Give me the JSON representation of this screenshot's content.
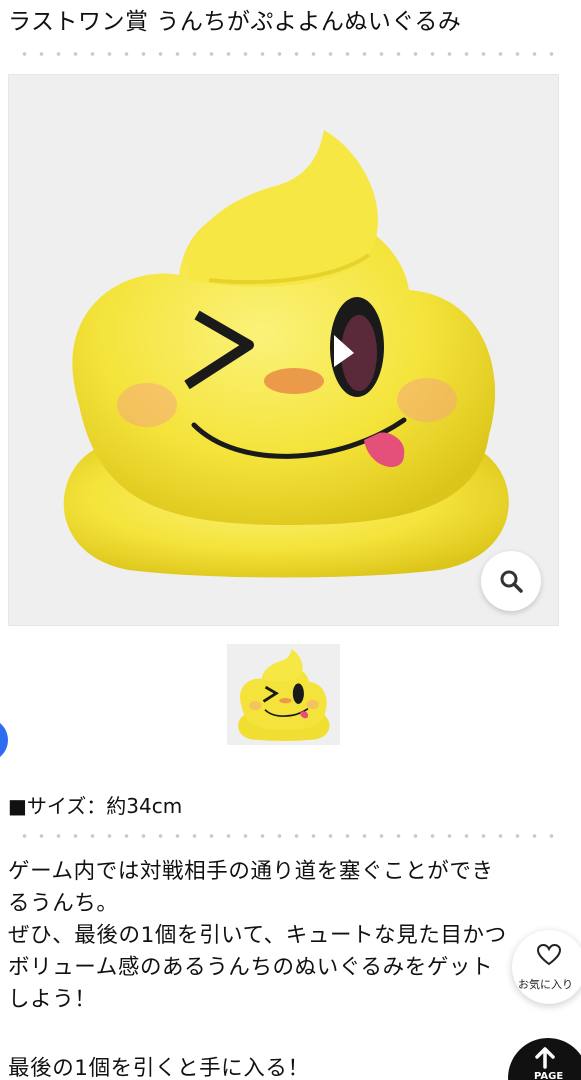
{
  "product": {
    "title": "ラストワン賞 うんちがぷよよんぬいぐるみ",
    "main_image_alt": "うんちがぷよよんぬいぐるみ",
    "size_text": "■サイズ：約34cm",
    "description_lines": [
      "ゲーム内では対戦相手の通り道を塞ぐことができ",
      "るうんち。",
      "ぜひ、最後の1個を引いて、キュートな見た目かつ",
      "ボリューム感のあるうんちのぬいぐるみをゲット",
      "しよう！"
    ],
    "last_line": "最後の1個を引くと手に入る！"
  },
  "buttons": {
    "zoom_icon": "magnifier-icon",
    "favorite_label": "お気に入り",
    "favorite_icon": "heart-icon",
    "pagetop_label": "PAGE",
    "pagetop_icon": "arrow-up-icon"
  },
  "colors": {
    "plush_yellow": "#f4e33a",
    "plush_shadow": "#e0c91c",
    "cheek": "#f4a77c",
    "tongue": "#e4507a",
    "side_tab": "#2d6cf0"
  }
}
